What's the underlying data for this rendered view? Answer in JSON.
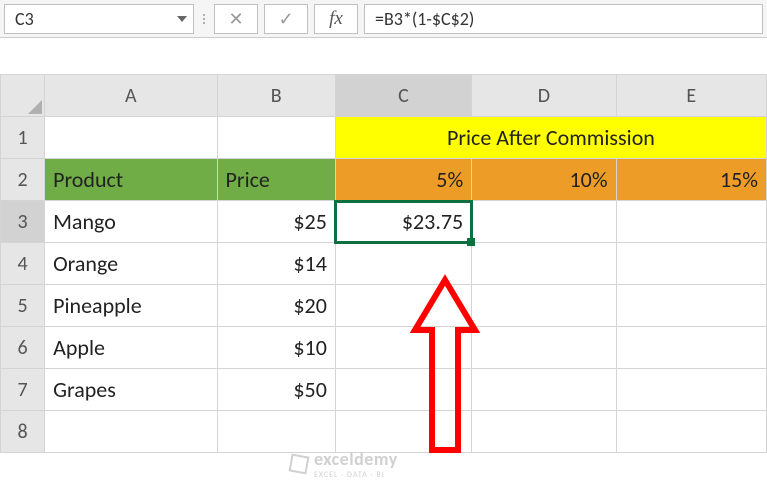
{
  "formula_bar": {
    "cell_ref": "C3",
    "cancel": "✕",
    "confirm": "✓",
    "fx": "fx",
    "formula": "=B3*(1-$C$2)"
  },
  "columns": [
    "A",
    "B",
    "C",
    "D",
    "E"
  ],
  "rows": [
    "1",
    "2",
    "3",
    "4",
    "5",
    "6",
    "7",
    "8"
  ],
  "cells": {
    "merged_header": "Price After Commission",
    "a2": "Product",
    "b2": "Price",
    "c2": "5%",
    "d2": "10%",
    "e2": "15%",
    "a3": "Mango",
    "b3": "$25",
    "c3": "$23.75",
    "a4": "Orange",
    "b4": "$14",
    "a5": "Pineapple",
    "b5": "$20",
    "a6": "Apple",
    "b6": "$10",
    "a7": "Grapes",
    "b7": "$50"
  },
  "watermark": {
    "brand": "exceldemy",
    "sub": "EXCEL · DATA · BI"
  },
  "chart_data": {
    "type": "table",
    "title": "Price After Commission",
    "columns": [
      "Product",
      "Price",
      "5%",
      "10%",
      "15%"
    ],
    "rows": [
      {
        "Product": "Mango",
        "Price": 25,
        "5%": 23.75,
        "10%": null,
        "15%": null
      },
      {
        "Product": "Orange",
        "Price": 14,
        "5%": null,
        "10%": null,
        "15%": null
      },
      {
        "Product": "Pineapple",
        "Price": 20,
        "5%": null,
        "10%": null,
        "15%": null
      },
      {
        "Product": "Apple",
        "Price": 10,
        "5%": null,
        "10%": null,
        "15%": null
      },
      {
        "Product": "Grapes",
        "Price": 50,
        "5%": null,
        "10%": null,
        "15%": null
      }
    ],
    "active_cell": {
      "ref": "C3",
      "formula": "=B3*(1-$C$2)",
      "value": 23.75
    }
  }
}
